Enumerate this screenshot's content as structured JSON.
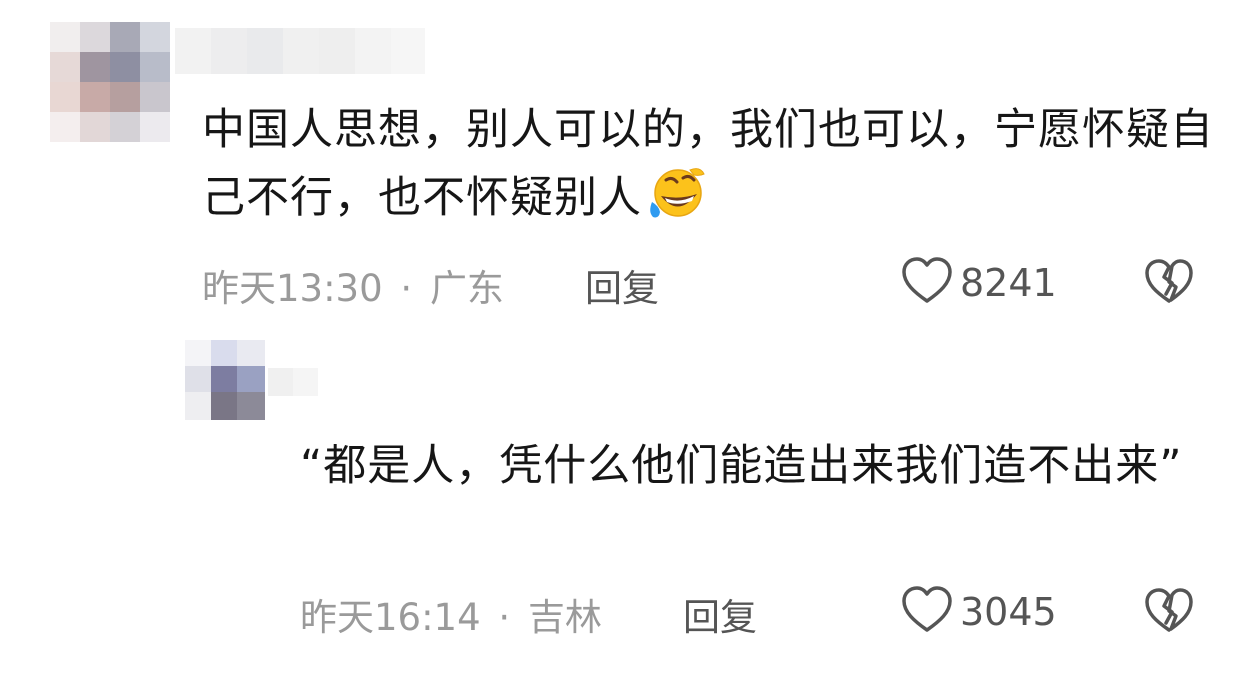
{
  "comments": [
    {
      "text": "中国人思想，别人可以的，我们也可以，宁愿怀疑自己不行，也不怀疑别人",
      "emoji": "rofl-emoji",
      "time": "昨天13:30",
      "location": "广东",
      "reply_label": "回复",
      "likes": "8241"
    },
    {
      "text": "“都是人，凭什么他们能造出来我们造不出来”",
      "time": "昨天16:14",
      "location": "吉林",
      "reply_label": "回复",
      "likes": "3045"
    }
  ],
  "separator": "·",
  "icons": {
    "like": "heart-outline-icon",
    "dislike": "broken-heart-icon"
  },
  "colors": {
    "text": "#161616",
    "meta": "#9a9a9a",
    "action": "#555555"
  }
}
